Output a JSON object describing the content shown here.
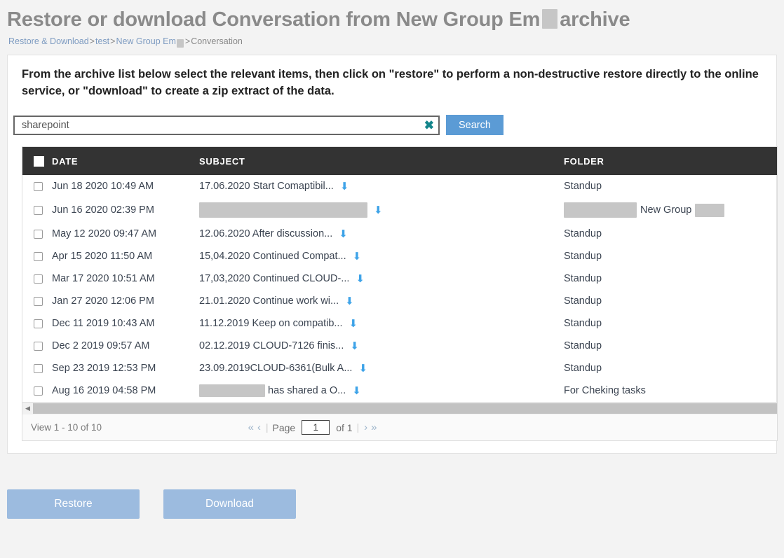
{
  "header": {
    "title_before": "Restore or download Conversation from New Group Em",
    "title_after": "archive"
  },
  "breadcrumb": {
    "root": "Restore & Download",
    "sep": ">",
    "level1": "test",
    "level2": "New Group Em",
    "current": "Conversation"
  },
  "instructions": {
    "text": "From the archive list below select the relevant items, then click on \"restore\" to perform a non-destructive restore directly to the online service, or \"download\" to create a zip extract of the data."
  },
  "search": {
    "value": "sharepoint",
    "placeholder": "",
    "clear_icon": "close-icon",
    "button_label": "Search"
  },
  "table": {
    "columns": [
      "DATE",
      "SUBJECT",
      "FOLDER"
    ],
    "rows": [
      {
        "date": "Jun 18 2020 10:49 AM",
        "subject": "17.06.2020 Start Comaptibil...",
        "subject_redacted": false,
        "folder": "Standup",
        "folder_redacted": false
      },
      {
        "date": "Jun 16 2020 02:39 PM",
        "subject": "",
        "subject_redacted": true,
        "folder": "New Group",
        "folder_redacted": true
      },
      {
        "date": "May 12 2020 09:47 AM",
        "subject": "12.06.2020 After discussion...",
        "subject_redacted": false,
        "folder": "Standup",
        "folder_redacted": false
      },
      {
        "date": "Apr 15 2020 11:50 AM",
        "subject": "15,04.2020 Continued Compat...",
        "subject_redacted": false,
        "folder": "Standup",
        "folder_redacted": false
      },
      {
        "date": "Mar 17 2020 10:51 AM",
        "subject": "17,03,2020 Continued CLOUD-...",
        "subject_redacted": false,
        "folder": "Standup",
        "folder_redacted": false
      },
      {
        "date": "Jan 27 2020 12:06 PM",
        "subject": "21.01.2020 Continue work wi...",
        "subject_redacted": false,
        "folder": "Standup",
        "folder_redacted": false
      },
      {
        "date": "Dec 11 2019 10:43 AM",
        "subject": "11.12.2019 Keep on compatib...",
        "subject_redacted": false,
        "folder": "Standup",
        "folder_redacted": false
      },
      {
        "date": "Dec 2 2019 09:57 AM",
        "subject": "02.12.2019 CLOUD-7126 finis...",
        "subject_redacted": false,
        "folder": "Standup",
        "folder_redacted": false
      },
      {
        "date": "Sep 23 2019 12:53 PM",
        "subject": "23.09.2019CLOUD-6361(Bulk A...",
        "subject_redacted": false,
        "folder": "Standup",
        "folder_redacted": false
      },
      {
        "date": "Aug 16 2019 04:58 PM",
        "subject": "has shared a O...",
        "subject_redacted": "partial",
        "folder": "For Cheking tasks",
        "folder_redacted": false
      }
    ],
    "download_icon": "download-arrow-icon"
  },
  "footer": {
    "view_count": "View 1 - 10 of 10",
    "first_icon": "«",
    "prev_icon": "‹",
    "page_label": "Page",
    "page_value": "1",
    "of_label": "of 1",
    "next_icon": "›",
    "last_icon": "»"
  },
  "actions": {
    "restore_label": "Restore",
    "download_label": "Download"
  },
  "colors": {
    "accent_blue": "#5b9bd5",
    "button_blue": "#9cbbdf",
    "header_dark": "#333333",
    "arrow_blue": "#3ea3e8",
    "clear_teal": "#13858b",
    "title_gray": "#8a8a8a",
    "page_bg": "#f3f3f3"
  }
}
